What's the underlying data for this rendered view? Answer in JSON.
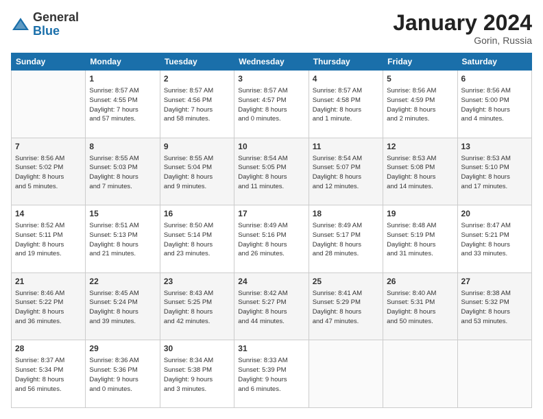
{
  "logo": {
    "general": "General",
    "blue": "Blue"
  },
  "header": {
    "month": "January 2024",
    "location": "Gorin, Russia"
  },
  "weekdays": [
    "Sunday",
    "Monday",
    "Tuesday",
    "Wednesday",
    "Thursday",
    "Friday",
    "Saturday"
  ],
  "weeks": [
    [
      {
        "day": "",
        "info": ""
      },
      {
        "day": "1",
        "info": "Sunrise: 8:57 AM\nSunset: 4:55 PM\nDaylight: 7 hours\nand 57 minutes."
      },
      {
        "day": "2",
        "info": "Sunrise: 8:57 AM\nSunset: 4:56 PM\nDaylight: 7 hours\nand 58 minutes."
      },
      {
        "day": "3",
        "info": "Sunrise: 8:57 AM\nSunset: 4:57 PM\nDaylight: 8 hours\nand 0 minutes."
      },
      {
        "day": "4",
        "info": "Sunrise: 8:57 AM\nSunset: 4:58 PM\nDaylight: 8 hours\nand 1 minute."
      },
      {
        "day": "5",
        "info": "Sunrise: 8:56 AM\nSunset: 4:59 PM\nDaylight: 8 hours\nand 2 minutes."
      },
      {
        "day": "6",
        "info": "Sunrise: 8:56 AM\nSunset: 5:00 PM\nDaylight: 8 hours\nand 4 minutes."
      }
    ],
    [
      {
        "day": "7",
        "info": "Sunrise: 8:56 AM\nSunset: 5:02 PM\nDaylight: 8 hours\nand 5 minutes."
      },
      {
        "day": "8",
        "info": "Sunrise: 8:55 AM\nSunset: 5:03 PM\nDaylight: 8 hours\nand 7 minutes."
      },
      {
        "day": "9",
        "info": "Sunrise: 8:55 AM\nSunset: 5:04 PM\nDaylight: 8 hours\nand 9 minutes."
      },
      {
        "day": "10",
        "info": "Sunrise: 8:54 AM\nSunset: 5:05 PM\nDaylight: 8 hours\nand 11 minutes."
      },
      {
        "day": "11",
        "info": "Sunrise: 8:54 AM\nSunset: 5:07 PM\nDaylight: 8 hours\nand 12 minutes."
      },
      {
        "day": "12",
        "info": "Sunrise: 8:53 AM\nSunset: 5:08 PM\nDaylight: 8 hours\nand 14 minutes."
      },
      {
        "day": "13",
        "info": "Sunrise: 8:53 AM\nSunset: 5:10 PM\nDaylight: 8 hours\nand 17 minutes."
      }
    ],
    [
      {
        "day": "14",
        "info": "Sunrise: 8:52 AM\nSunset: 5:11 PM\nDaylight: 8 hours\nand 19 minutes."
      },
      {
        "day": "15",
        "info": "Sunrise: 8:51 AM\nSunset: 5:13 PM\nDaylight: 8 hours\nand 21 minutes."
      },
      {
        "day": "16",
        "info": "Sunrise: 8:50 AM\nSunset: 5:14 PM\nDaylight: 8 hours\nand 23 minutes."
      },
      {
        "day": "17",
        "info": "Sunrise: 8:49 AM\nSunset: 5:16 PM\nDaylight: 8 hours\nand 26 minutes."
      },
      {
        "day": "18",
        "info": "Sunrise: 8:49 AM\nSunset: 5:17 PM\nDaylight: 8 hours\nand 28 minutes."
      },
      {
        "day": "19",
        "info": "Sunrise: 8:48 AM\nSunset: 5:19 PM\nDaylight: 8 hours\nand 31 minutes."
      },
      {
        "day": "20",
        "info": "Sunrise: 8:47 AM\nSunset: 5:21 PM\nDaylight: 8 hours\nand 33 minutes."
      }
    ],
    [
      {
        "day": "21",
        "info": "Sunrise: 8:46 AM\nSunset: 5:22 PM\nDaylight: 8 hours\nand 36 minutes."
      },
      {
        "day": "22",
        "info": "Sunrise: 8:45 AM\nSunset: 5:24 PM\nDaylight: 8 hours\nand 39 minutes."
      },
      {
        "day": "23",
        "info": "Sunrise: 8:43 AM\nSunset: 5:25 PM\nDaylight: 8 hours\nand 42 minutes."
      },
      {
        "day": "24",
        "info": "Sunrise: 8:42 AM\nSunset: 5:27 PM\nDaylight: 8 hours\nand 44 minutes."
      },
      {
        "day": "25",
        "info": "Sunrise: 8:41 AM\nSunset: 5:29 PM\nDaylight: 8 hours\nand 47 minutes."
      },
      {
        "day": "26",
        "info": "Sunrise: 8:40 AM\nSunset: 5:31 PM\nDaylight: 8 hours\nand 50 minutes."
      },
      {
        "day": "27",
        "info": "Sunrise: 8:38 AM\nSunset: 5:32 PM\nDaylight: 8 hours\nand 53 minutes."
      }
    ],
    [
      {
        "day": "28",
        "info": "Sunrise: 8:37 AM\nSunset: 5:34 PM\nDaylight: 8 hours\nand 56 minutes."
      },
      {
        "day": "29",
        "info": "Sunrise: 8:36 AM\nSunset: 5:36 PM\nDaylight: 9 hours\nand 0 minutes."
      },
      {
        "day": "30",
        "info": "Sunrise: 8:34 AM\nSunset: 5:38 PM\nDaylight: 9 hours\nand 3 minutes."
      },
      {
        "day": "31",
        "info": "Sunrise: 8:33 AM\nSunset: 5:39 PM\nDaylight: 9 hours\nand 6 minutes."
      },
      {
        "day": "",
        "info": ""
      },
      {
        "day": "",
        "info": ""
      },
      {
        "day": "",
        "info": ""
      }
    ]
  ]
}
